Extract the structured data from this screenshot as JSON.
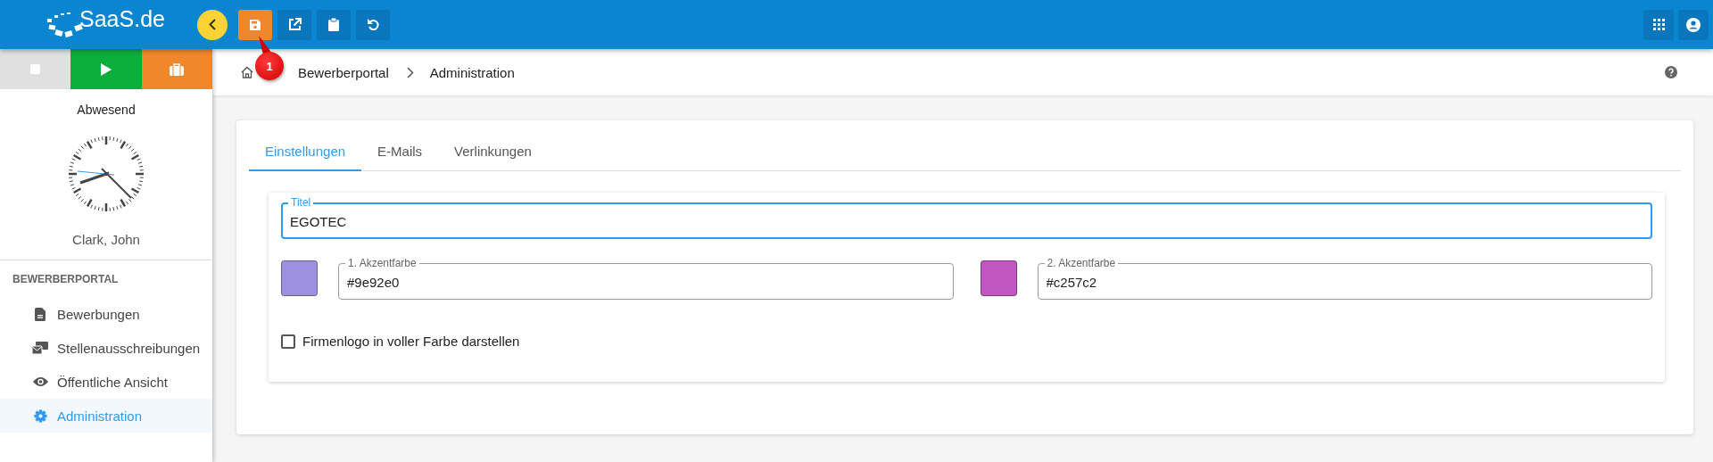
{
  "header": {
    "logo": "SaaS.de",
    "toolbar": [
      {
        "kind": "save",
        "color": "#f0872a"
      },
      {
        "kind": "open-external",
        "color": "#0a76bd"
      },
      {
        "kind": "clipboard",
        "color": "#0a76bd"
      },
      {
        "kind": "undo",
        "color": "#0a76bd"
      }
    ],
    "right_buttons": [
      {
        "kind": "apps"
      },
      {
        "kind": "account"
      }
    ]
  },
  "annotation": {
    "label": "1"
  },
  "sidebar": {
    "status_buttons": [
      {
        "kind": "stop",
        "color": "#e0e0e0"
      },
      {
        "kind": "play",
        "color": "#0cae3c"
      },
      {
        "kind": "break",
        "color": "#f0872a"
      }
    ],
    "status": "Abwesend",
    "user": "Clark, John",
    "section": "BEWERBERPORTAL",
    "items": [
      {
        "label": "Bewerbungen",
        "kind": "file",
        "selected": false
      },
      {
        "label": "Stellenausschreibungen",
        "kind": "jobs",
        "selected": false
      },
      {
        "label": "Öffentliche Ansicht",
        "kind": "eye",
        "selected": false
      },
      {
        "label": "Administration",
        "kind": "gear",
        "selected": true
      }
    ]
  },
  "breadcrumb": [
    "Bewerberportal",
    "Administration"
  ],
  "tabs": [
    {
      "label": "Einstellungen",
      "selected": true
    },
    {
      "label": "E-Mails",
      "selected": false
    },
    {
      "label": "Verlinkungen",
      "selected": false
    }
  ],
  "form": {
    "title_field": {
      "label": "Titel",
      "value": "EGOTEC",
      "focused": true
    },
    "colors": [
      {
        "label": "1. Akzentfarbe",
        "value": "#9e92e0",
        "color": "#9e92e0"
      },
      {
        "label": "2. Akzentfarbe",
        "value": "#c257c2",
        "color": "#c257c2"
      }
    ],
    "checkbox": {
      "label": "Firmenlogo in voller Farbe darstellen",
      "checked": false
    }
  }
}
